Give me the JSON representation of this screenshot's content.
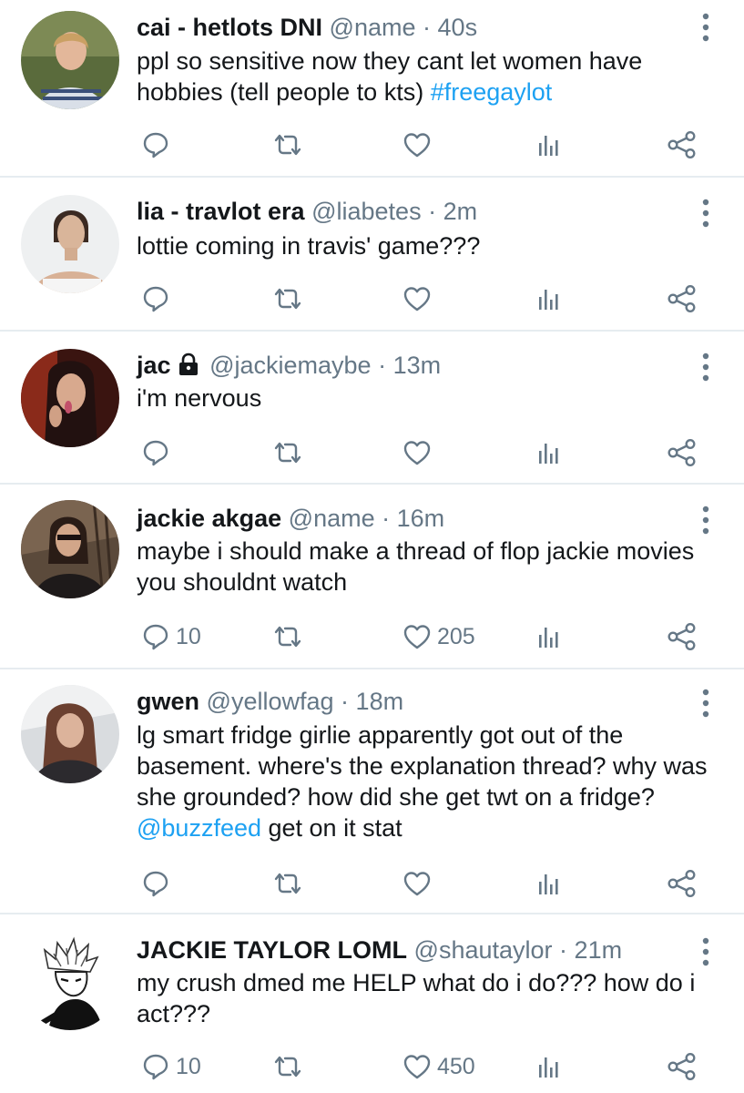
{
  "colors": {
    "link": "#1da1f2",
    "muted": "#657786",
    "text": "#14171a",
    "divider": "#e6ecf0"
  },
  "icons": {
    "reply": "reply-icon",
    "retweet": "retweet-icon",
    "like": "like-icon",
    "analytics": "analytics-icon",
    "share": "share-icon",
    "more": "more-vertical-icon",
    "lock": "lock-icon"
  },
  "tweets": [
    {
      "name": "cai - hetlots DNI",
      "handle": "@name",
      "dot": "·",
      "time": "40s",
      "text_before": "ppl so sensitive now they cant let women have hobbies (tell people to kts) ",
      "link": "#freegaylot",
      "text_after": "",
      "replies": "",
      "likes": ""
    },
    {
      "name": "lia - travlot era",
      "handle": "@liabetes",
      "dot": "·",
      "time": "2m",
      "text_before": "lottie coming in travis' game???",
      "link": "",
      "text_after": "",
      "replies": "",
      "likes": ""
    },
    {
      "name": "jac",
      "handle": "@jackiemaybe",
      "dot": "·",
      "time": "13m",
      "text_before": "i'm nervous",
      "link": "",
      "text_after": "",
      "replies": "",
      "likes": ""
    },
    {
      "name": "jackie akgae",
      "handle": "@name",
      "dot": "·",
      "time": "16m",
      "text_before": "maybe i should make a thread of flop jackie movies you shouldnt watch",
      "link": "",
      "text_after": "",
      "replies": "10",
      "likes": "205"
    },
    {
      "name": "gwen",
      "handle": "@yellowfag",
      "dot": "·",
      "time": "18m",
      "text_before": "lg smart fridge girlie apparently got out of the basement. where's the explanation thread? why was she grounded? how did she get twt on a fridge? ",
      "link": "@buzzfeed",
      "text_after": " get on it stat",
      "replies": "",
      "likes": ""
    },
    {
      "name": "JACKIE TAYLOR LOML",
      "handle": "@shautaylor",
      "dot": "·",
      "time": "21m",
      "text_before": "my crush dmed me HELP what do i do??? how do i act???",
      "link": "",
      "text_after": "",
      "replies": "10",
      "likes": "450"
    }
  ]
}
